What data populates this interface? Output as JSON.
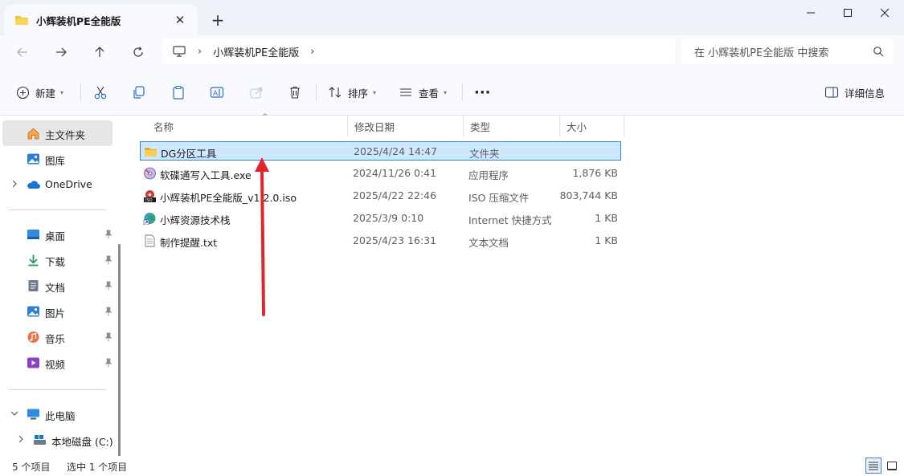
{
  "window": {
    "tab_title": "小辉装机PE全能版",
    "new_tab": "+",
    "close_tab": "✕"
  },
  "nav": {
    "breadcrumb": [
      "小辉装机PE全能版"
    ],
    "search_placeholder": "在 小辉装机PE全能版 中搜索"
  },
  "toolbar": {
    "new_label": "新建",
    "sort_label": "排序",
    "view_label": "查看",
    "more_label": "···",
    "details_label": "详细信息"
  },
  "sidebar": {
    "home": "主文件夹",
    "gallery": "图库",
    "onedrive": "OneDrive",
    "desktop": "桌面",
    "downloads": "下载",
    "documents": "文档",
    "pictures": "图片",
    "music": "音乐",
    "videos": "视频",
    "this_pc": "此电脑",
    "local_disk": "本地磁盘 (C:)"
  },
  "columns": {
    "name": "名称",
    "modified": "修改日期",
    "type": "类型",
    "size": "大小"
  },
  "files": [
    {
      "name": "DG分区工具",
      "date": "2025/4/24 14:47",
      "type": "文件夹",
      "size": "",
      "icon": "folder-icon"
    },
    {
      "name": "软碟通写入工具.exe",
      "date": "2024/11/26 0:41",
      "type": "应用程序",
      "size": "1,876 KB",
      "icon": "disc-app-icon"
    },
    {
      "name": "小辉装机PE全能版_v1.2.0.iso",
      "date": "2025/4/22 22:46",
      "type": "ISO 压缩文件",
      "size": "803,744 KB",
      "icon": "iso-file-icon"
    },
    {
      "name": "小辉资源技术栈",
      "date": "2025/3/9 0:10",
      "type": "Internet 快捷方式",
      "size": "1 KB",
      "icon": "edge-shortcut-icon"
    },
    {
      "name": "制作提醒.txt",
      "date": "2025/4/23 16:31",
      "type": "文本文档",
      "size": "1 KB",
      "icon": "text-file-icon"
    }
  ],
  "status": {
    "item_count": "5 个项目",
    "selected": "选中 1 个项目"
  },
  "colors": {
    "selection_bg": "#cce8ff",
    "selection_border": "#3d7ed8",
    "annotation_arrow": "#e0252e",
    "folder": "#f4c13b"
  }
}
